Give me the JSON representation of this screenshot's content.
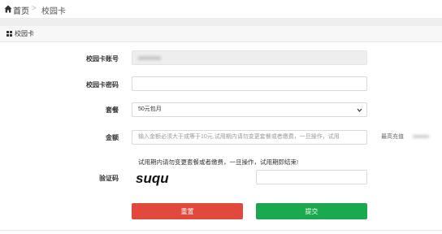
{
  "breadcrumb": {
    "home_label": "首页",
    "separator": ">",
    "current_label": "校园卡"
  },
  "panel": {
    "title": "校园卡"
  },
  "form": {
    "account": {
      "label": "校园卡账号",
      "value": ""
    },
    "password": {
      "label": "校园卡密码",
      "value": ""
    },
    "package": {
      "label": "套餐",
      "selected": "50元包月"
    },
    "amount": {
      "label": "金额",
      "placeholder": "输入金额必须大于或等于10元,试用期内请勿变更套餐或者缴费，一旦操作，试用",
      "hint": "最高充值"
    },
    "notice": "试用期内请勿变更套餐或者缴费，一旦操作，试用期即结束!",
    "captcha": {
      "label": "验证码",
      "image_text": "suqu",
      "value": ""
    }
  },
  "buttons": {
    "reset": "重置",
    "submit": "提交"
  },
  "colors": {
    "reset": "#e1493d",
    "submit": "#1aa94f",
    "readonly_bg": "#eeeeee"
  },
  "icons": {
    "home": "home-icon",
    "panel": "grid-icon",
    "select": "chevron-down-icon"
  }
}
